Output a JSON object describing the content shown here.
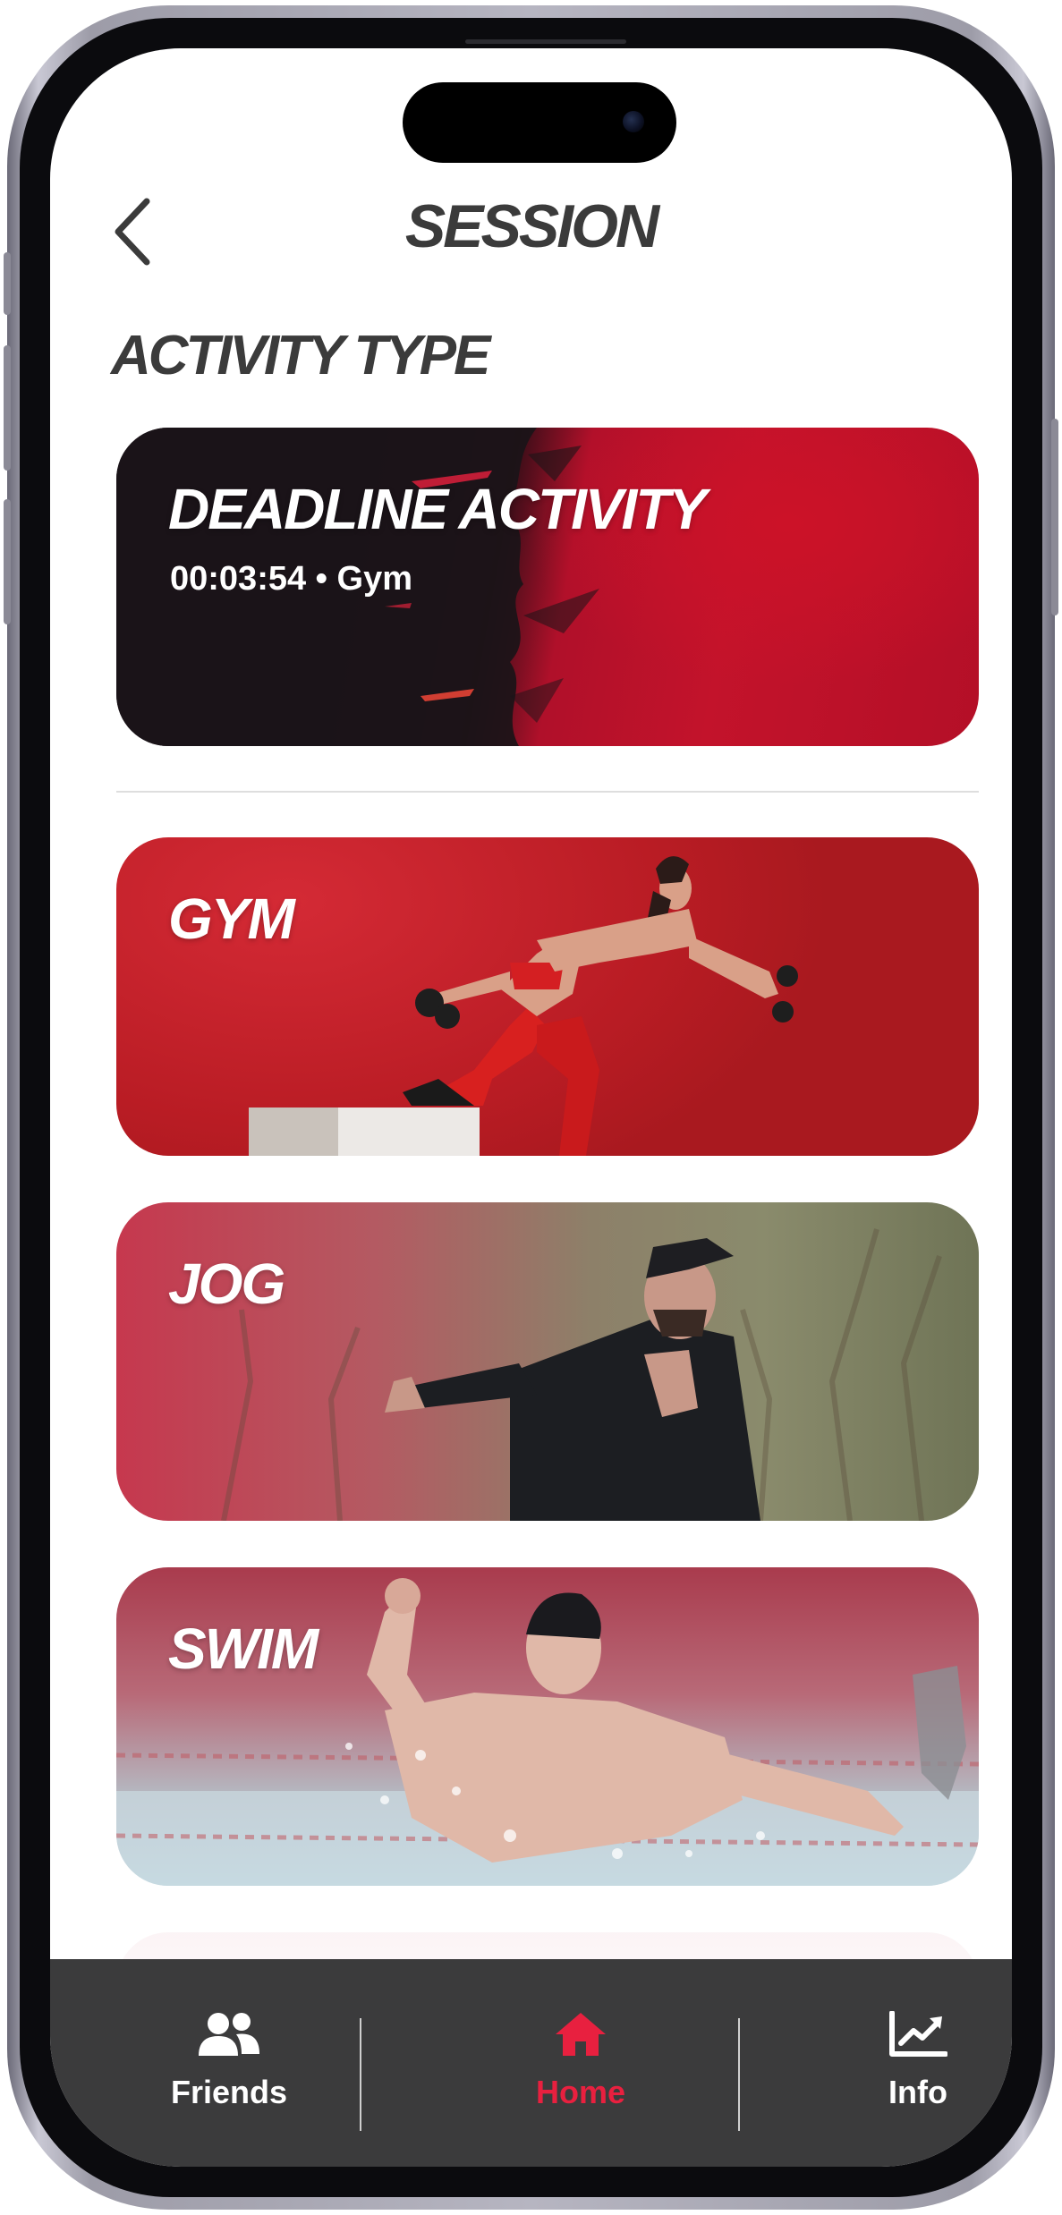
{
  "header": {
    "title": "SESSION",
    "back_icon": "chevron-left-icon"
  },
  "section": {
    "title": "ACTIVITY TYPE"
  },
  "deadline_card": {
    "title": "DEADLINE ACTIVITY",
    "subtitle": "00:03:54 • Gym"
  },
  "activities": [
    {
      "title": "GYM"
    },
    {
      "title": "JOG"
    },
    {
      "title": "SWIM"
    }
  ],
  "bottom_nav": {
    "items": [
      {
        "label": "Friends",
        "icon": "friends-icon",
        "active": false
      },
      {
        "label": "Home",
        "icon": "home-icon",
        "active": true
      },
      {
        "label": "Info",
        "icon": "chart-icon",
        "active": false
      }
    ]
  },
  "colors": {
    "accent": "#e8203f",
    "text_dark": "#3b3b3b",
    "nav_bg": "#3b3b3c",
    "card_red": "#c3132b"
  }
}
